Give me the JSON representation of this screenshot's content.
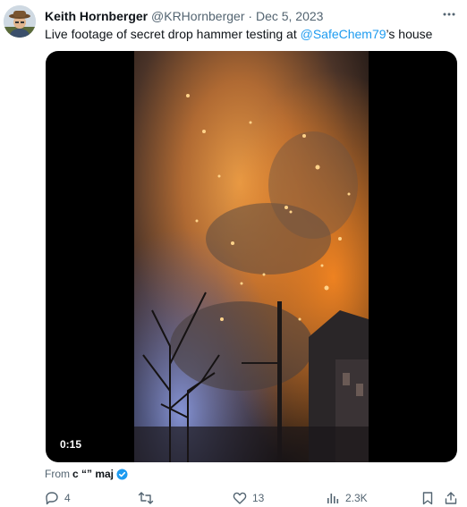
{
  "tweet": {
    "author_name": "Keith Hornberger",
    "handle": "@KRHornberger",
    "separator": "·",
    "date": "Dec 5, 2023",
    "text_before": "Live footage of secret drop hammer testing at ",
    "mention": "@SafeChem79",
    "text_after": "’s house"
  },
  "media": {
    "duration": "0:15"
  },
  "source": {
    "prefix": "From",
    "name": "c “” maj"
  },
  "actions": {
    "replies": "4",
    "retweets": "",
    "likes": "13",
    "views": "2.3K"
  },
  "colors": {
    "accent": "#1d9bf0",
    "muted": "#536471",
    "text": "#0f1419"
  },
  "icons": [
    "user-avatar",
    "more-icon",
    "verified-badge-icon",
    "reply-icon",
    "retweet-icon",
    "like-icon",
    "views-icon",
    "bookmark-icon",
    "share-icon"
  ]
}
